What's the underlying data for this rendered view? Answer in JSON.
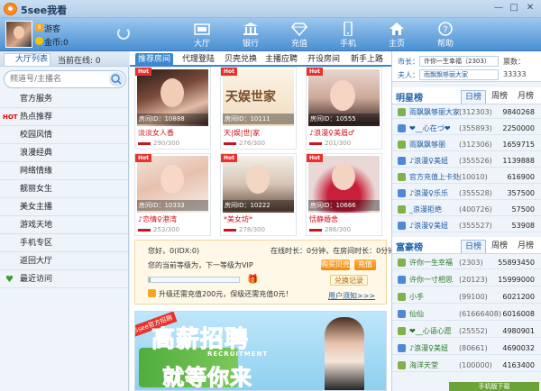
{
  "window": {
    "title": "5see我看",
    "min": "—",
    "max": "□",
    "close": "✕"
  },
  "user": {
    "level": "9",
    "name": "游客",
    "coin_label": "金币:0"
  },
  "nav": [
    {
      "label": "大厅"
    },
    {
      "label": "银行"
    },
    {
      "label": "充值"
    },
    {
      "label": "手机"
    },
    {
      "label": "主页"
    },
    {
      "label": "帮助"
    }
  ],
  "sidebar": {
    "tab": "大厅列表",
    "online_label": "当前在线: 0",
    "search_placeholder": "频道号/主播名",
    "items": [
      {
        "label": "官方服务",
        "hot": ""
      },
      {
        "label": "热点推荐",
        "hot": "HOT"
      },
      {
        "label": "校园风情",
        "hot": ""
      },
      {
        "label": "浪漫经典",
        "hot": ""
      },
      {
        "label": "网络情缘",
        "hot": ""
      },
      {
        "label": "靓丽女生",
        "hot": ""
      },
      {
        "label": "美女主播",
        "hot": ""
      },
      {
        "label": "游戏天地",
        "hot": ""
      },
      {
        "label": "手机专区",
        "hot": ""
      },
      {
        "label": "返回大厅",
        "hot": ""
      },
      {
        "label": "最近访问",
        "hot": ""
      }
    ]
  },
  "tabs": [
    "推荐房间",
    "代理登陆",
    "贝壳兑换",
    "主播应聘",
    "开设房间",
    "新手上路"
  ],
  "rooms": [
    {
      "hot": "Hot",
      "room_id": "房间ID：10888",
      "name": "淡淡女人香",
      "count": "290/300"
    },
    {
      "hot": "Hot",
      "room_id": "房间ID：10111",
      "name": "天|娱|世|家",
      "count": "276/300"
    },
    {
      "hot": "Hot",
      "room_id": "房间ID：10555",
      "name": "♪浪漫♀美眉♂",
      "count": "201/300"
    },
    {
      "hot": "Hot",
      "room_id": "房间ID：10333",
      "name": "♪恋情♀港湾",
      "count": "253/300"
    },
    {
      "hot": "Hot",
      "room_id": "房间ID：10222",
      "name": "*美女坊*",
      "count": "278/300"
    },
    {
      "hot": "Hot",
      "room_id": "房间ID：10666",
      "name": "恬静婚舍",
      "count": "286/300"
    }
  ],
  "panel": {
    "greeting": "您好，0(IDX:0)",
    "online_time": "在线时长：0分钟，在房间时长：0分钟",
    "level_text": "您的当前等级为，下一等级为VIP",
    "buy_label": "购买贝壳",
    "recharge_label": "充值",
    "diamond_label": "兑换记录",
    "upgrade_text": "升级还需充值200元，保级还需充值0元！",
    "detail_label": "用户须知>>>",
    "progress": 0.02
  },
  "banner": {
    "badge": "5see官方招聘",
    "line1": "高薪招聘",
    "recruit": "RECRUITMENT",
    "line2": "就等你来"
  },
  "right": {
    "market_label": "市长：",
    "market_value": "许你一生幸福（2303）",
    "wife_label": "夫人：",
    "wife_value": "雨飘飘够丽大家",
    "votes_label": "票数：",
    "votes_value": "33333"
  },
  "star_rank": {
    "title": "明星榜",
    "tabs": [
      "日榜",
      "周榜",
      "月榜"
    ],
    "rows": [
      {
        "name": "雨飘飘够丽大家",
        "id": "(312303)",
        "value": "9840268"
      },
      {
        "name": "❤__心在づ❤",
        "id": "(355893)",
        "value": "2250000"
      },
      {
        "name": "雨飘飘够丽",
        "id": "(312306)",
        "value": "1659715"
      },
      {
        "name": "♪浪漫♀美妞",
        "id": "(355526)",
        "value": "1139888"
      },
      {
        "name": "官方充值上卡处",
        "id": "(10010)",
        "value": "616900"
      },
      {
        "name": "♪浪漫♀乐乐",
        "id": "(355528)",
        "value": "357500"
      },
      {
        "name": "_浪漫拒绝",
        "id": "(400726)",
        "value": "57500"
      },
      {
        "name": "♪浪漫♀美妞",
        "id": "(355527)",
        "value": "53908"
      }
    ]
  },
  "rich_rank": {
    "title": "富豪榜",
    "tabs": [
      "日榜",
      "周榜",
      "月榜"
    ],
    "rows": [
      {
        "name": "许你一生幸福",
        "id": "(2303)",
        "value": "55893450"
      },
      {
        "name": "许你一寸相思",
        "id": "(20123)",
        "value": "15999000"
      },
      {
        "name": "小手",
        "id": "(99100)",
        "value": "6021200"
      },
      {
        "name": "仙仙",
        "id": "(61666408)",
        "value": "6016008"
      },
      {
        "name": "❤__心语心愿",
        "id": "(25552)",
        "value": "4980901"
      },
      {
        "name": "♪浪漫♀美妞",
        "id": "(80661)",
        "value": "4690032"
      },
      {
        "name": "海洋天堂",
        "id": "(100000)",
        "value": "4163400"
      }
    ]
  },
  "download_label": "手机版下载",
  "colors": {
    "accent": "#3e86cf",
    "hot": "#e8322b",
    "name": "#d0121b",
    "star": "#2164ad"
  }
}
